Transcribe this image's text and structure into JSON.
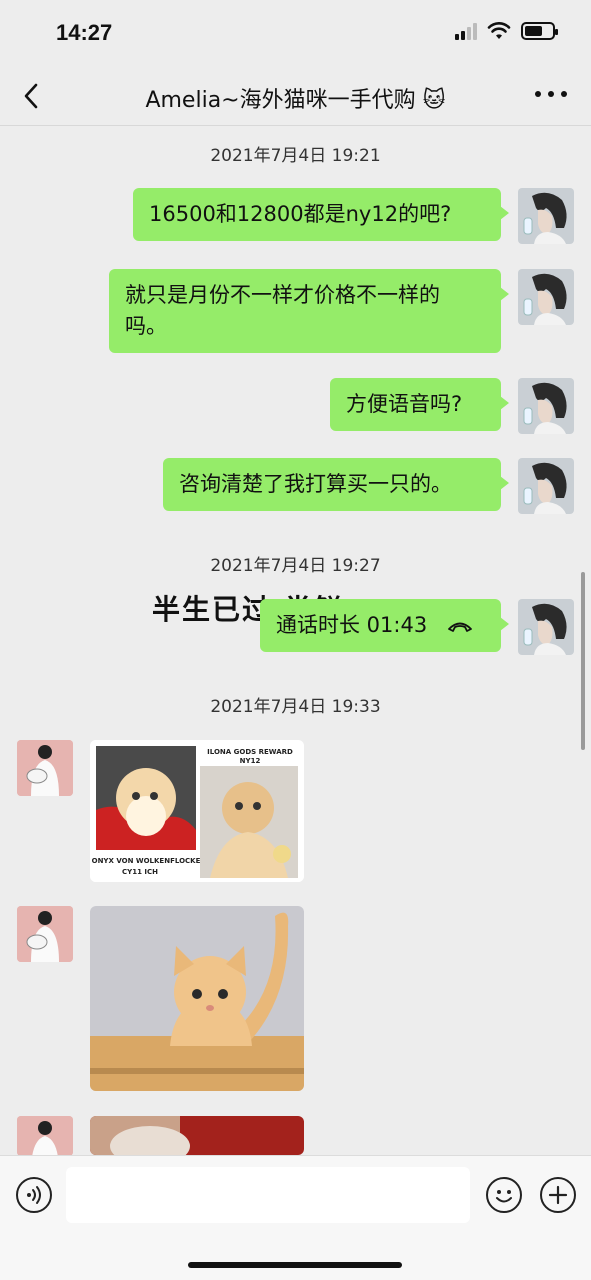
{
  "status_bar": {
    "time": "14:27",
    "battery_level": 0.65
  },
  "header": {
    "title": "Amelia~海外猫咪一手代购 🐱"
  },
  "messages": {
    "ts1": "2021年7月4日 19:21",
    "m1": "16500和12800都是ny12的吧?",
    "m2_line1": "就只是月份不一样才价格不一样的",
    "m2_line2": "吗。",
    "m3": "方便语音吗?",
    "m4": "咨询清楚了我打算买一只的。",
    "ts2": "2021年7月4日 19:27",
    "overlay": "半生已过  尝鲜",
    "call": "通话时长 01:43",
    "ts3": "2021年7月4日 19:33"
  },
  "images": {
    "img1_left_caption_1": "ONYX VON WOLKENFLOCKE",
    "img1_left_caption_2": "CY11 ICH",
    "img1_right_title_1": "ILONA GODS REWARD",
    "img1_right_title_2": "NY12"
  },
  "colors": {
    "bubble_me": "#95ec69",
    "background": "#ededed"
  },
  "icons": [
    "back-icon",
    "more-icon",
    "voice-icon",
    "emoji-icon",
    "plus-icon",
    "phone-icon"
  ]
}
